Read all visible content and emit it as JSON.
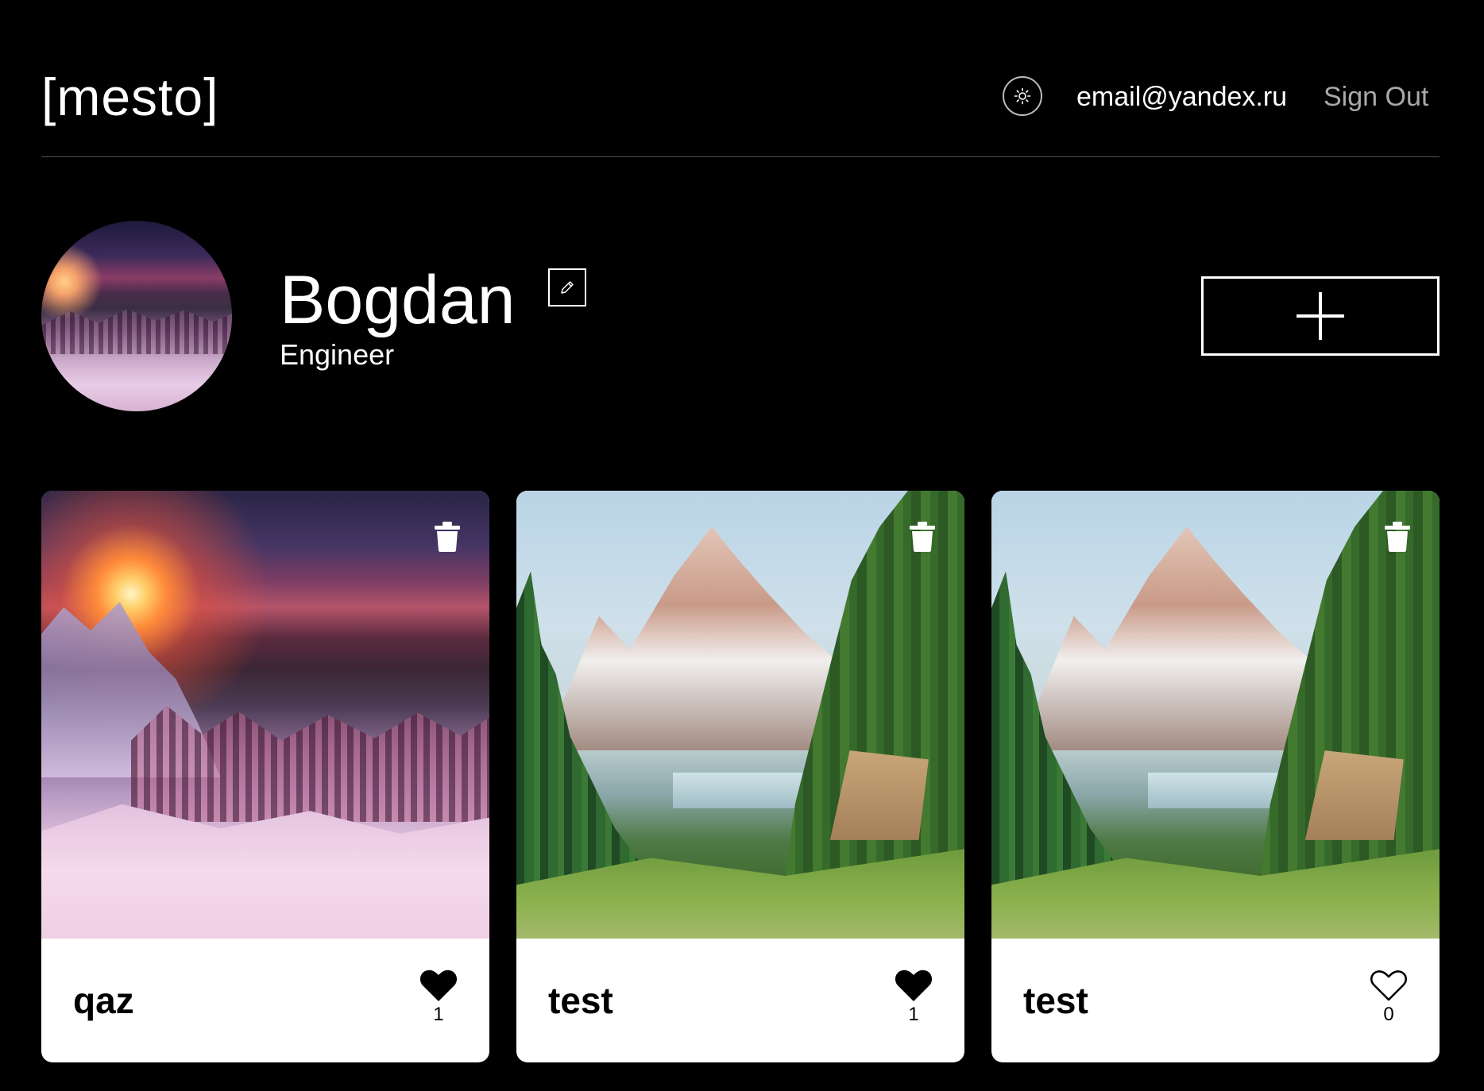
{
  "header": {
    "logo": "[mesto]",
    "theme_toggle_icon": "sun-icon",
    "user_email": "email@yandex.ru",
    "sign_out_label": "Sign Out"
  },
  "profile": {
    "name": "Bogdan",
    "about": "Engineer",
    "edit_icon": "pencil-icon",
    "add_icon": "plus-icon"
  },
  "cards": [
    {
      "title": "qaz",
      "likes": "1",
      "liked": true,
      "image": "winter-sunset-mountains"
    },
    {
      "title": "test",
      "likes": "1",
      "liked": true,
      "image": "mountain-lake-forest"
    },
    {
      "title": "test",
      "likes": "0",
      "liked": false,
      "image": "mountain-lake-forest"
    }
  ],
  "colors": {
    "background": "#000000",
    "card_background": "#ffffff",
    "header_divider": "#545454",
    "sign_out": "#a9a9a9"
  }
}
